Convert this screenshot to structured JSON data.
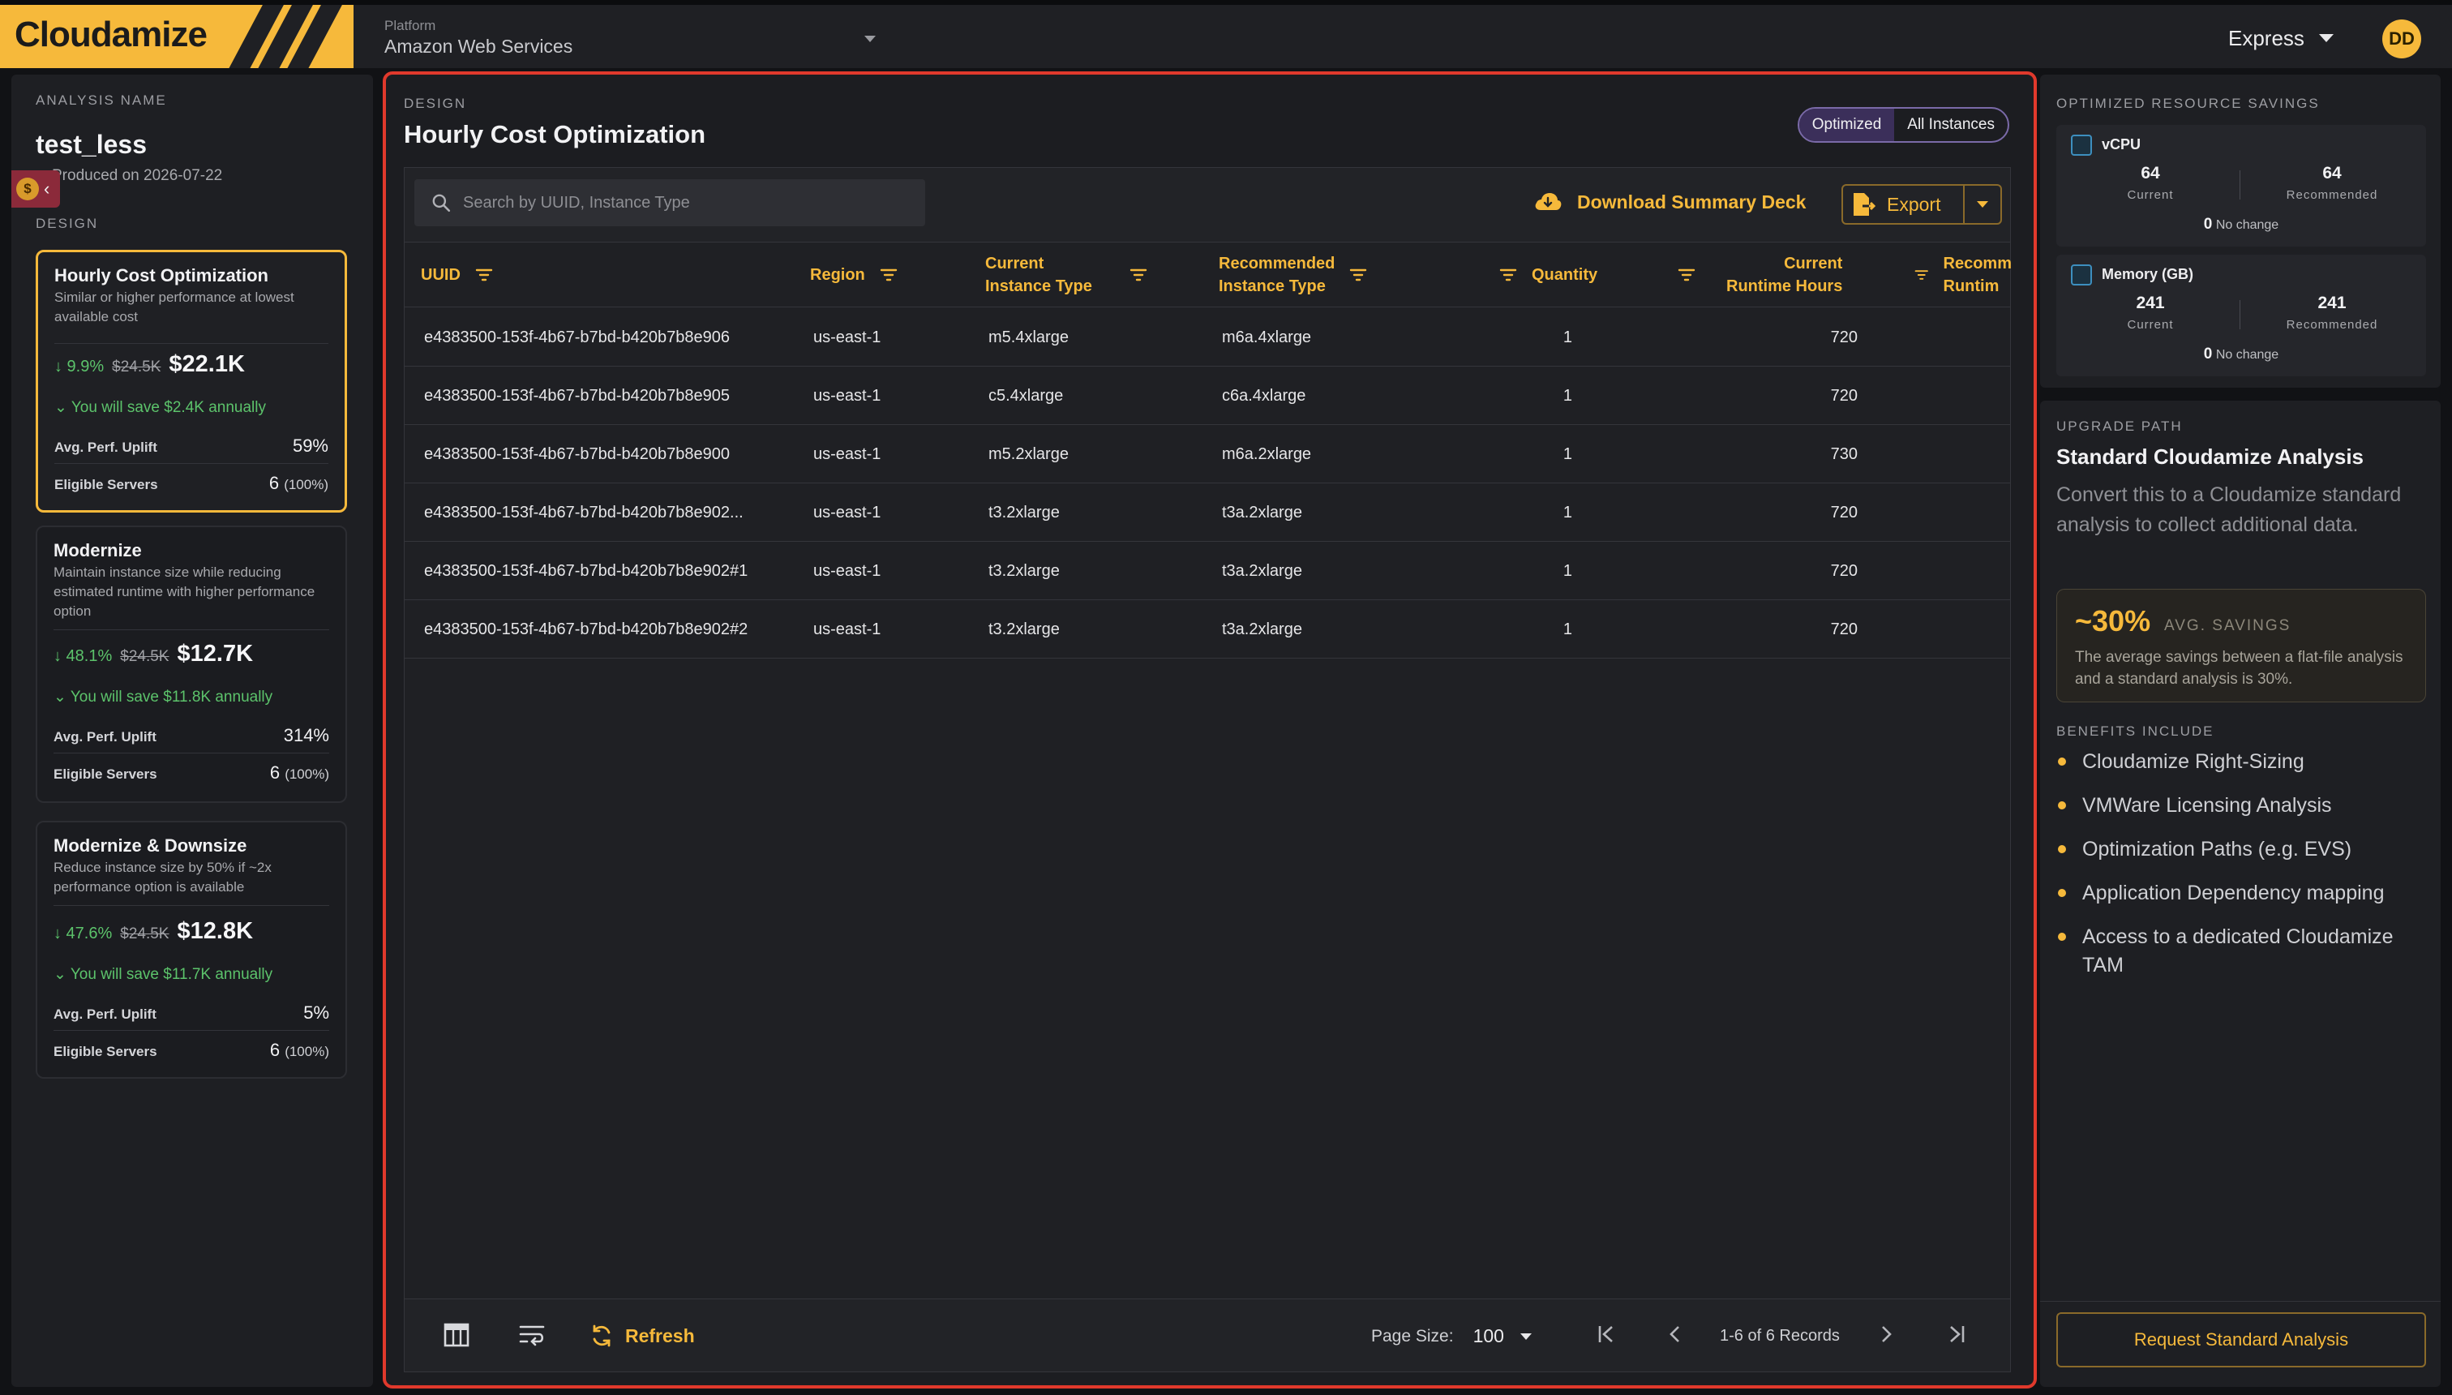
{
  "app": {
    "logo": "Cloudamize",
    "platform_label": "Platform",
    "platform_value": "Amazon Web Services",
    "mode": "Express",
    "user_initials": "DD"
  },
  "left": {
    "analysis_label": "ANALYSIS NAME",
    "analysis_name": "test_less",
    "produced": "Produced on 2026-07-22",
    "design_label": "DESIGN",
    "cards": [
      {
        "title": "Hourly Cost Optimization",
        "desc": "Similar or higher performance at lowest available cost",
        "pct": "↓ 9.9%",
        "old": "$24.5K",
        "new": "$22.1K",
        "save": "You will save $2.4K annually",
        "uplift_label": "Avg. Perf. Uplift",
        "uplift": "59%",
        "servers_label": "Eligible Servers",
        "servers": "6",
        "servers_pct": "(100%)"
      },
      {
        "title": "Modernize",
        "desc": "Maintain instance size while reducing estimated runtime with higher performance option",
        "pct": "↓ 48.1%",
        "old": "$24.5K",
        "new": "$12.7K",
        "save": "You will save $11.8K annually",
        "uplift_label": "Avg. Perf. Uplift",
        "uplift": "314%",
        "servers_label": "Eligible Servers",
        "servers": "6",
        "servers_pct": "(100%)"
      },
      {
        "title": "Modernize & Downsize",
        "desc": "Reduce instance size by 50% if ~2x performance option is available",
        "pct": "↓ 47.6%",
        "old": "$24.5K",
        "new": "$12.8K",
        "save": "You will save $11.7K annually",
        "uplift_label": "Avg. Perf. Uplift",
        "uplift": "5%",
        "servers_label": "Eligible Servers",
        "servers": "6",
        "servers_pct": "(100%)"
      }
    ]
  },
  "main": {
    "eyebrow": "DESIGN",
    "title": "Hourly Cost Optimization",
    "toggle": [
      "Optimized",
      "All Instances"
    ],
    "search_placeholder": "Search by UUID, Instance Type",
    "download_label": "Download Summary Deck",
    "export_label": "Export",
    "columns": {
      "uuid": "UUID",
      "region": "Region",
      "current_type": [
        "Current",
        "Instance Type"
      ],
      "recommended_type": [
        "Recommended",
        "Instance Type"
      ],
      "quantity": "Quantity",
      "runtime": [
        "Current",
        "Runtime Hours"
      ],
      "recommended_runtime": [
        "Recomm",
        "Runtim"
      ]
    },
    "rows": [
      {
        "uuid": "e4383500-153f-4b67-b7bd-b420b7b8e906",
        "region": "us-east-1",
        "current": "m5.4xlarge",
        "recommended": "m6a.4xlarge",
        "qty": "1",
        "hours": "720"
      },
      {
        "uuid": "e4383500-153f-4b67-b7bd-b420b7b8e905",
        "region": "us-east-1",
        "current": "c5.4xlarge",
        "recommended": "c6a.4xlarge",
        "qty": "1",
        "hours": "720"
      },
      {
        "uuid": "e4383500-153f-4b67-b7bd-b420b7b8e900",
        "region": "us-east-1",
        "current": "m5.2xlarge",
        "recommended": "m6a.2xlarge",
        "qty": "1",
        "hours": "730"
      },
      {
        "uuid": "e4383500-153f-4b67-b7bd-b420b7b8e902...",
        "region": "us-east-1",
        "current": "t3.2xlarge",
        "recommended": "t3a.2xlarge",
        "qty": "1",
        "hours": "720"
      },
      {
        "uuid": "e4383500-153f-4b67-b7bd-b420b7b8e902#1",
        "region": "us-east-1",
        "current": "t3.2xlarge",
        "recommended": "t3a.2xlarge",
        "qty": "1",
        "hours": "720"
      },
      {
        "uuid": "e4383500-153f-4b67-b7bd-b420b7b8e902#2",
        "region": "us-east-1",
        "current": "t3.2xlarge",
        "recommended": "t3a.2xlarge",
        "qty": "1",
        "hours": "720"
      }
    ],
    "footer": {
      "refresh": "Refresh",
      "page_size_label": "Page Size:",
      "page_size": "100",
      "records": "1-6 of 6 Records"
    }
  },
  "savings": {
    "eyebrow": "OPTIMIZED RESOURCE SAVINGS",
    "resources": [
      {
        "name": "vCPU",
        "current": "64",
        "recommended": "64",
        "current_label": "Current",
        "recommended_label": "Recommended",
        "change": "0",
        "change_label": "No change"
      },
      {
        "name": "Memory (GB)",
        "current": "241",
        "recommended": "241",
        "current_label": "Current",
        "recommended_label": "Recommended",
        "change": "0",
        "change_label": "No change"
      }
    ]
  },
  "upgrade": {
    "eyebrow": "UPGRADE PATH",
    "title": "Standard Cloudamize Analysis",
    "desc": "Convert this to a Cloudamize standard analysis to collect additional data.",
    "savings_big": "~30%",
    "savings_label": "AVG. SAVINGS",
    "savings_text": "The average savings between a flat-file analysis and a standard analysis is 30%.",
    "benefits_label": "BENEFITS INCLUDE",
    "benefits": [
      "Cloudamize Right-Sizing",
      "VMWare Licensing Analysis",
      "Optimization Paths (e.g. EVS)",
      "Application Dependency mapping",
      "Access to a dedicated Cloudamize TAM"
    ],
    "request_button": "Request Standard Analysis"
  },
  "colors": {
    "accent": "#f6b93b",
    "positive": "#5cc36b",
    "highlight_border": "#e0392c"
  }
}
